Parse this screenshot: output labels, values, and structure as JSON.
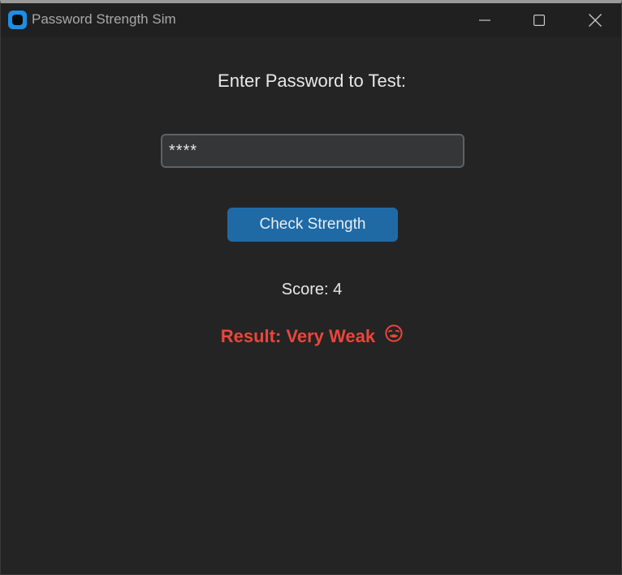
{
  "window": {
    "title": "Password Strength Sim",
    "icon": "app-icon",
    "controls": [
      "minimize-icon",
      "maximize-icon",
      "close-icon"
    ]
  },
  "form": {
    "prompt": "Enter Password to Test:",
    "password_value": "****",
    "check_button_label": "Check Strength"
  },
  "output": {
    "score_text": "Score: 4",
    "result_text": "Result: Very Weak",
    "result_icon": "nauseated-face-emoji",
    "result_color": "#e8473c"
  },
  "colors": {
    "background": "#242424",
    "titlebar": "#202020",
    "accent_button": "#1f6aa5",
    "input_bg": "#343638",
    "input_border": "#5d6266"
  }
}
